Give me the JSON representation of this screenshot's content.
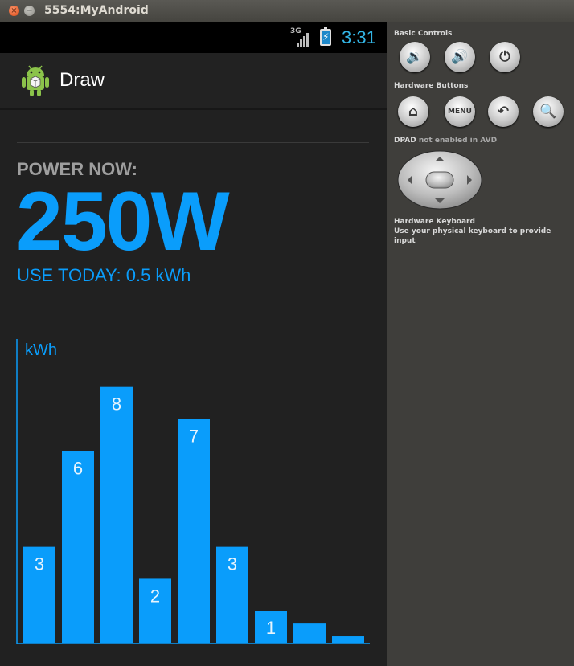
{
  "window": {
    "title": "5554:MyAndroid",
    "close_glyph": "×",
    "minimize_glyph": "−"
  },
  "statusbar": {
    "network": "3G",
    "clock": "3:31",
    "battery_charging_glyph": "⚡",
    "accent": "#33b5e5"
  },
  "actionbar": {
    "title": "Draw",
    "icon": "android-robot-icon"
  },
  "main": {
    "power_label": "POWER NOW:",
    "power_value": "250W",
    "use_today": "USE TODAY: 0.5 kWh",
    "accent": "#0a9dfb"
  },
  "chart_data": {
    "type": "bar",
    "ylabel": "kWh",
    "values": [
      3,
      6,
      8,
      2,
      7,
      3,
      1,
      0.6,
      0.2
    ],
    "data_labels": [
      "3",
      "6",
      "8",
      "2",
      "7",
      "3",
      "1",
      "",
      ""
    ],
    "ylim": [
      0,
      9.5
    ],
    "grid": false,
    "color": "#0a9dfb"
  },
  "controls": {
    "basic_label": "Basic Controls",
    "hardware_label": "Hardware Buttons",
    "menu_label": "MENU",
    "dpad_label": "DPAD",
    "dpad_note": "not enabled in AVD",
    "keyboard_label": "Hardware Keyboard",
    "keyboard_note": "Use your physical keyboard to provide input",
    "volume_down_glyph": "🔉",
    "volume_up_glyph": "🔊",
    "power_glyph": "⏻",
    "home_glyph": "⌂",
    "back_glyph": "↶",
    "search_glyph": "🔍"
  }
}
